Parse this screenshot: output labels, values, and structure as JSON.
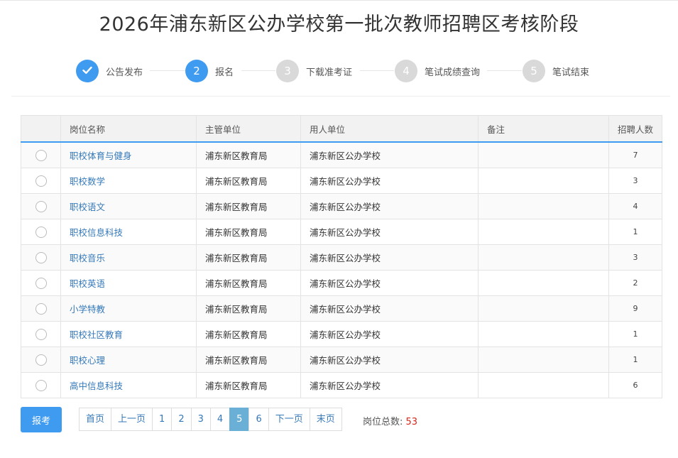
{
  "title": "2026年浦东新区公办学校第一批次教师招聘区考核阶段",
  "steps": [
    {
      "label": "公告发布",
      "num": "",
      "state": "done"
    },
    {
      "label": "报名",
      "num": "2",
      "state": "active"
    },
    {
      "label": "下载准考证",
      "num": "3",
      "state": "pending"
    },
    {
      "label": "笔试成绩查询",
      "num": "4",
      "state": "pending"
    },
    {
      "label": "笔试结束",
      "num": "5",
      "state": "pending"
    }
  ],
  "table": {
    "headers": [
      "岗位名称",
      "主管单位",
      "用人单位",
      "备注",
      "招聘人数"
    ],
    "rows": [
      {
        "post": "职校体育与健身",
        "dept": "浦东新区教育局",
        "school": "浦东新区公办学校",
        "note": "",
        "count": "7"
      },
      {
        "post": "职校数学",
        "dept": "浦东新区教育局",
        "school": "浦东新区公办学校",
        "note": "",
        "count": "3"
      },
      {
        "post": "职校语文",
        "dept": "浦东新区教育局",
        "school": "浦东新区公办学校",
        "note": "",
        "count": "4"
      },
      {
        "post": "职校信息科技",
        "dept": "浦东新区教育局",
        "school": "浦东新区公办学校",
        "note": "",
        "count": "1"
      },
      {
        "post": "职校音乐",
        "dept": "浦东新区教育局",
        "school": "浦东新区公办学校",
        "note": "",
        "count": "3"
      },
      {
        "post": "职校英语",
        "dept": "浦东新区教育局",
        "school": "浦东新区公办学校",
        "note": "",
        "count": "2"
      },
      {
        "post": "小学特教",
        "dept": "浦东新区教育局",
        "school": "浦东新区公办学校",
        "note": "",
        "count": "9"
      },
      {
        "post": "职校社区教育",
        "dept": "浦东新区教育局",
        "school": "浦东新区公办学校",
        "note": "",
        "count": "1"
      },
      {
        "post": "职校心理",
        "dept": "浦东新区教育局",
        "school": "浦东新区公办学校",
        "note": "",
        "count": "1"
      },
      {
        "post": "高中信息科技",
        "dept": "浦东新区教育局",
        "school": "浦东新区公办学校",
        "note": "",
        "count": "6"
      }
    ]
  },
  "apply_button": "报考",
  "pagination": {
    "items": [
      "首页",
      "上一页",
      "1",
      "2",
      "3",
      "4",
      "5",
      "6",
      "下一页",
      "末页"
    ],
    "current": "5"
  },
  "total": {
    "label": "岗位总数:",
    "value": "53"
  },
  "colors": {
    "accent": "#3f9bf0",
    "link": "#3579b8",
    "current_page": "#6ab0d6",
    "total_value": "#d9261c"
  },
  "icons": {
    "done_step": "check-icon"
  }
}
